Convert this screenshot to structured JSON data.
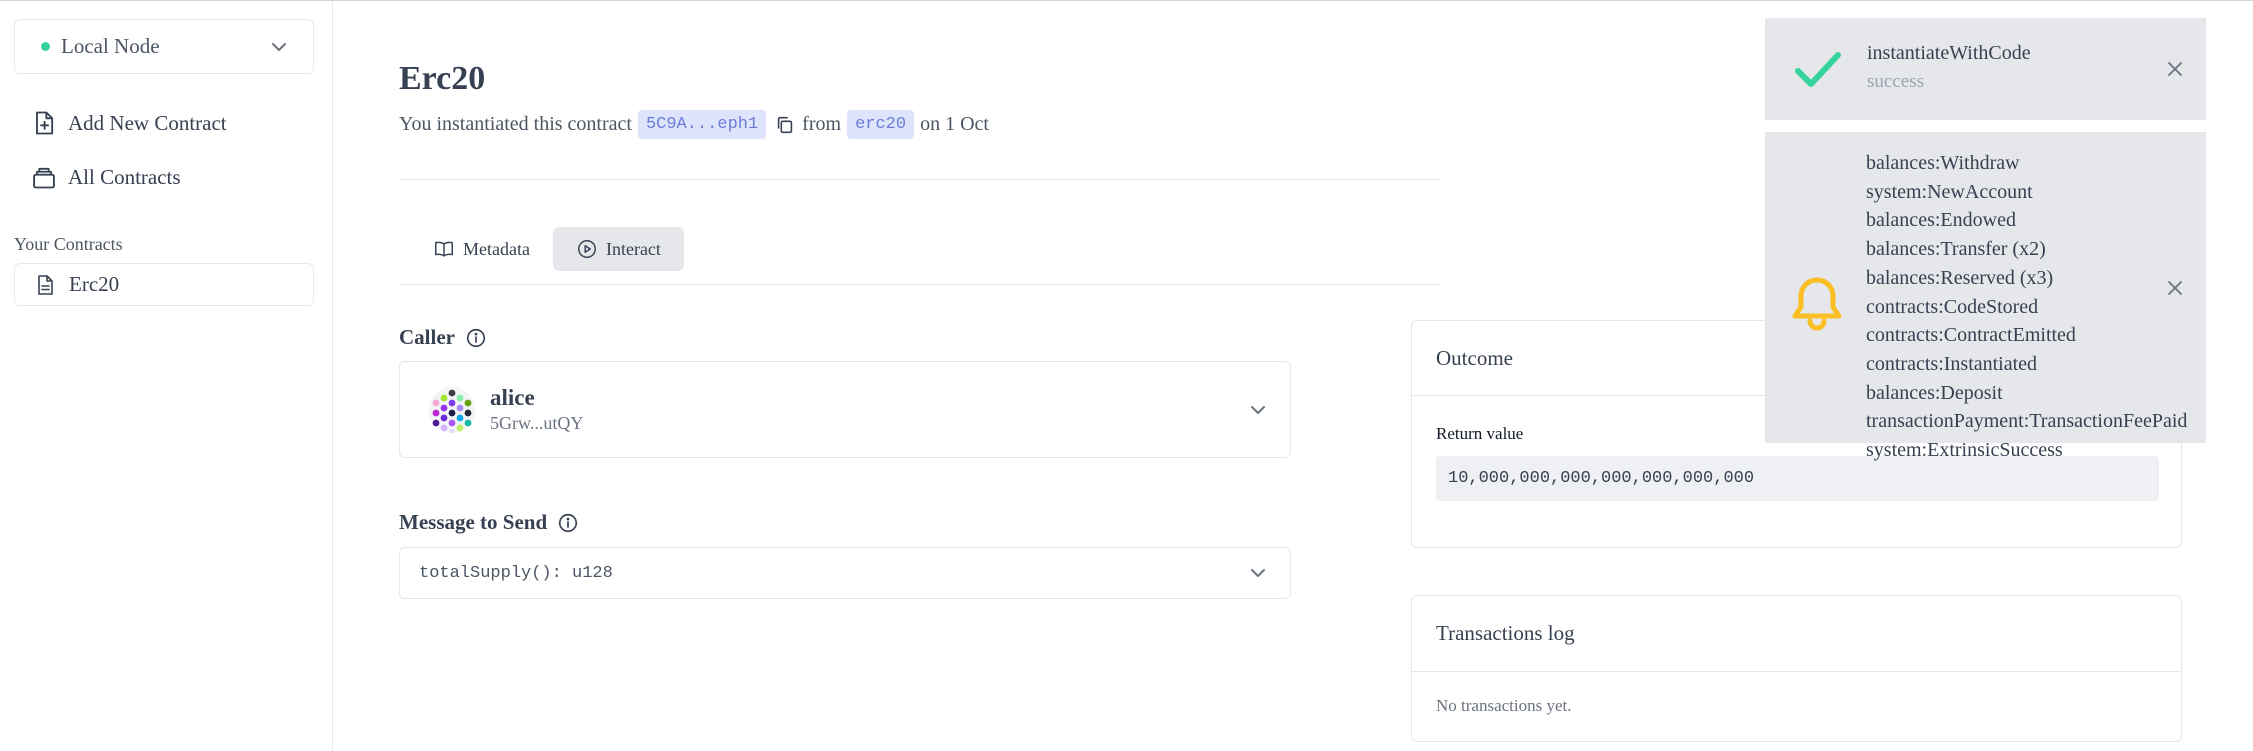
{
  "sidebar": {
    "node_label": "Local Node",
    "nav": [
      {
        "label": "Add New Contract",
        "icon": "document-add-icon"
      },
      {
        "label": "All Contracts",
        "icon": "collection-icon"
      }
    ],
    "section_title": "Your Contracts",
    "contracts": [
      {
        "label": "Erc20",
        "icon": "document-icon"
      }
    ]
  },
  "main": {
    "title": "Erc20",
    "subtitle": {
      "prefix": "You instantiated this contract",
      "address": "5C9A...eph1",
      "from_word": "from",
      "code_name": "erc20",
      "date_text": "on 1 Oct"
    },
    "tabs": [
      {
        "label": "Metadata",
        "icon": "book-icon",
        "active": false
      },
      {
        "label": "Interact",
        "icon": "play-icon",
        "active": true
      }
    ],
    "caller": {
      "label": "Caller",
      "name": "alice",
      "address": "5Grw...utQY"
    },
    "message": {
      "label": "Message to Send",
      "value": "totalSupply(): u128"
    }
  },
  "outcome": {
    "title": "Outcome",
    "return_label": "Return value",
    "return_value": "10,000,000,000,000,000,000,000"
  },
  "transactions": {
    "title": "Transactions log",
    "empty_text": "No transactions yet."
  },
  "toasts": {
    "success": {
      "title": "instantiateWithCode",
      "status": "success",
      "icon": "check-icon",
      "color": "#34d399"
    },
    "events": {
      "icon": "bell-icon",
      "color": "#fbbf24",
      "items": [
        "balances:Withdraw",
        "system:NewAccount",
        "balances:Endowed",
        "balances:Transfer (x2)",
        "balances:Reserved (x3)",
        "contracts:CodeStored",
        "contracts:ContractEmitted",
        "contracts:Instantiated",
        "balances:Deposit",
        "transactionPayment:TransactionFeePaid",
        "system:ExtrinsicSuccess"
      ]
    }
  },
  "colors": {
    "accent_chip_bg": "#dde4fb",
    "accent_chip_text": "#6b7cd8",
    "status_green": "#34d399",
    "warning_yellow": "#fbbf24"
  }
}
